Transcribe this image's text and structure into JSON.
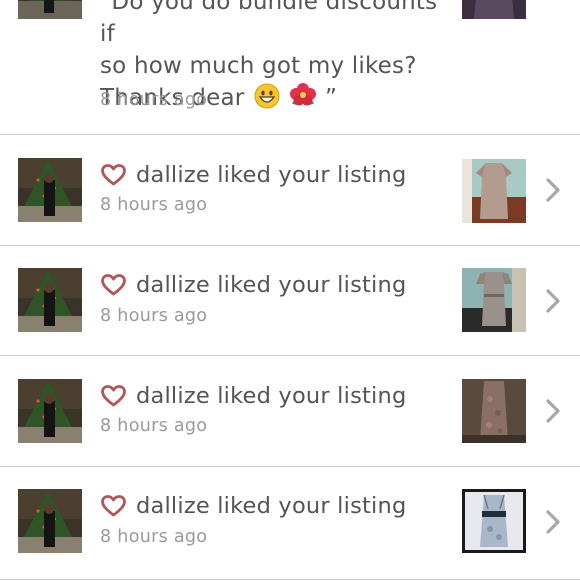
{
  "comment_item": {
    "text_line1": "“Do you do bundle discounts if",
    "text_line2": "so how much got my likes?",
    "text_line3": "Thanks dear",
    "emoji_icons": [
      "grinning-face-icon",
      "hibiscus-icon"
    ],
    "closing_quote": "”",
    "time": "8 hours ago"
  },
  "notifications": [
    {
      "user": "dallize",
      "action_text": "dallize liked your listing",
      "time": "8 hours ago",
      "icon": "heart-outline-icon",
      "thumb": "tan-dress"
    },
    {
      "user": "dallize",
      "action_text": "dallize liked your listing",
      "time": "8 hours ago",
      "icon": "heart-outline-icon",
      "thumb": "grey-dress"
    },
    {
      "user": "dallize",
      "action_text": "dallize liked your listing",
      "time": "8 hours ago",
      "icon": "heart-outline-icon",
      "thumb": "floral-dress"
    },
    {
      "user": "dallize",
      "action_text": "dallize liked your listing",
      "time": "8 hours ago",
      "icon": "heart-outline-icon",
      "thumb": "blue-dress"
    }
  ],
  "colors": {
    "heart": "#b0575c",
    "text": "#555555",
    "time": "#9a9a9a",
    "divider": "#cfcfcf",
    "chevron": "#a8a8a8"
  }
}
